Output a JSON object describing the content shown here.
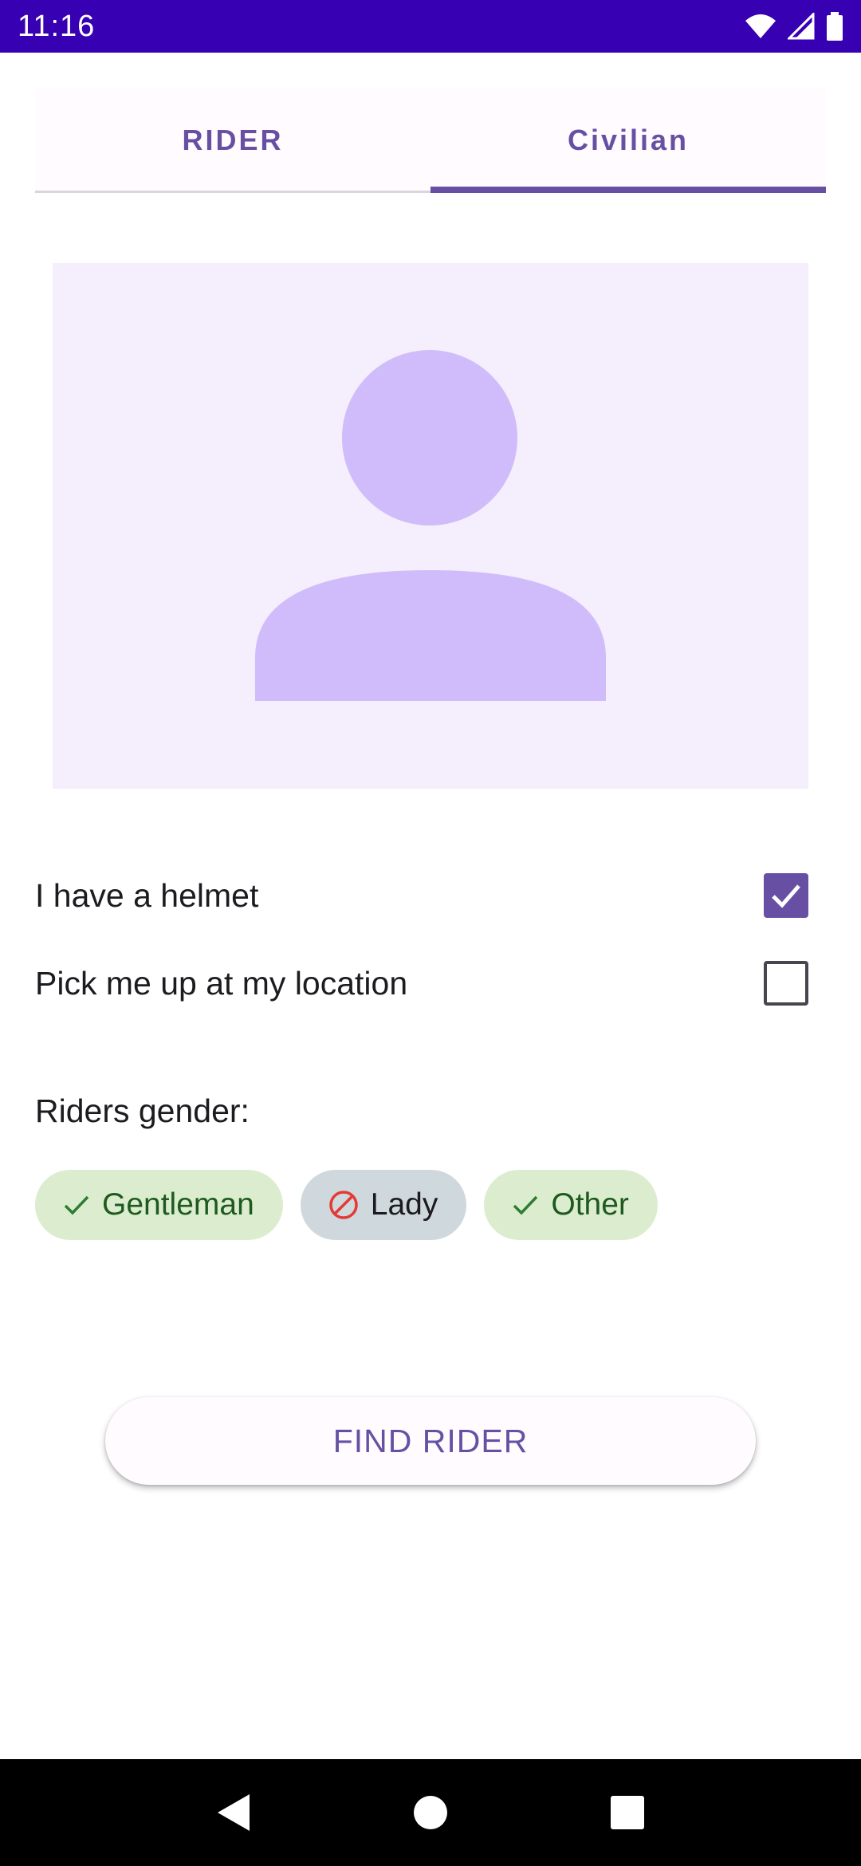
{
  "status_bar": {
    "time": "11:16",
    "icons": [
      "wifi-icon",
      "cell-signal-icon",
      "battery-icon"
    ]
  },
  "tabs": [
    {
      "label": "RIDER",
      "active": false
    },
    {
      "label": "Civilian",
      "active": true
    }
  ],
  "avatar": {
    "icon": "person-placeholder-icon"
  },
  "options": [
    {
      "label": "I have a helmet",
      "checked": true
    },
    {
      "label": "Pick me up at my location",
      "checked": false
    }
  ],
  "gender": {
    "label": "Riders gender:",
    "chips": [
      {
        "label": "Gentleman",
        "state": "included",
        "icon": "check-icon"
      },
      {
        "label": "Lady",
        "state": "excluded",
        "icon": "block-icon"
      },
      {
        "label": "Other",
        "state": "included",
        "icon": "check-icon"
      }
    ]
  },
  "find_button": {
    "label": "FIND RIDER"
  },
  "nav_bar": {
    "buttons": [
      "back-icon",
      "home-icon",
      "recents-icon"
    ]
  },
  "colors": {
    "status_bar": "#3700b3",
    "primary": "#6750a4",
    "avatar_bg": "#f4eefd",
    "avatar_fg": "#d0bcfa",
    "chip_included": "#dcedcf",
    "chip_excluded": "#cfd8dc",
    "excluded_icon": "#e53935",
    "included_icon": "#2e7d32"
  }
}
